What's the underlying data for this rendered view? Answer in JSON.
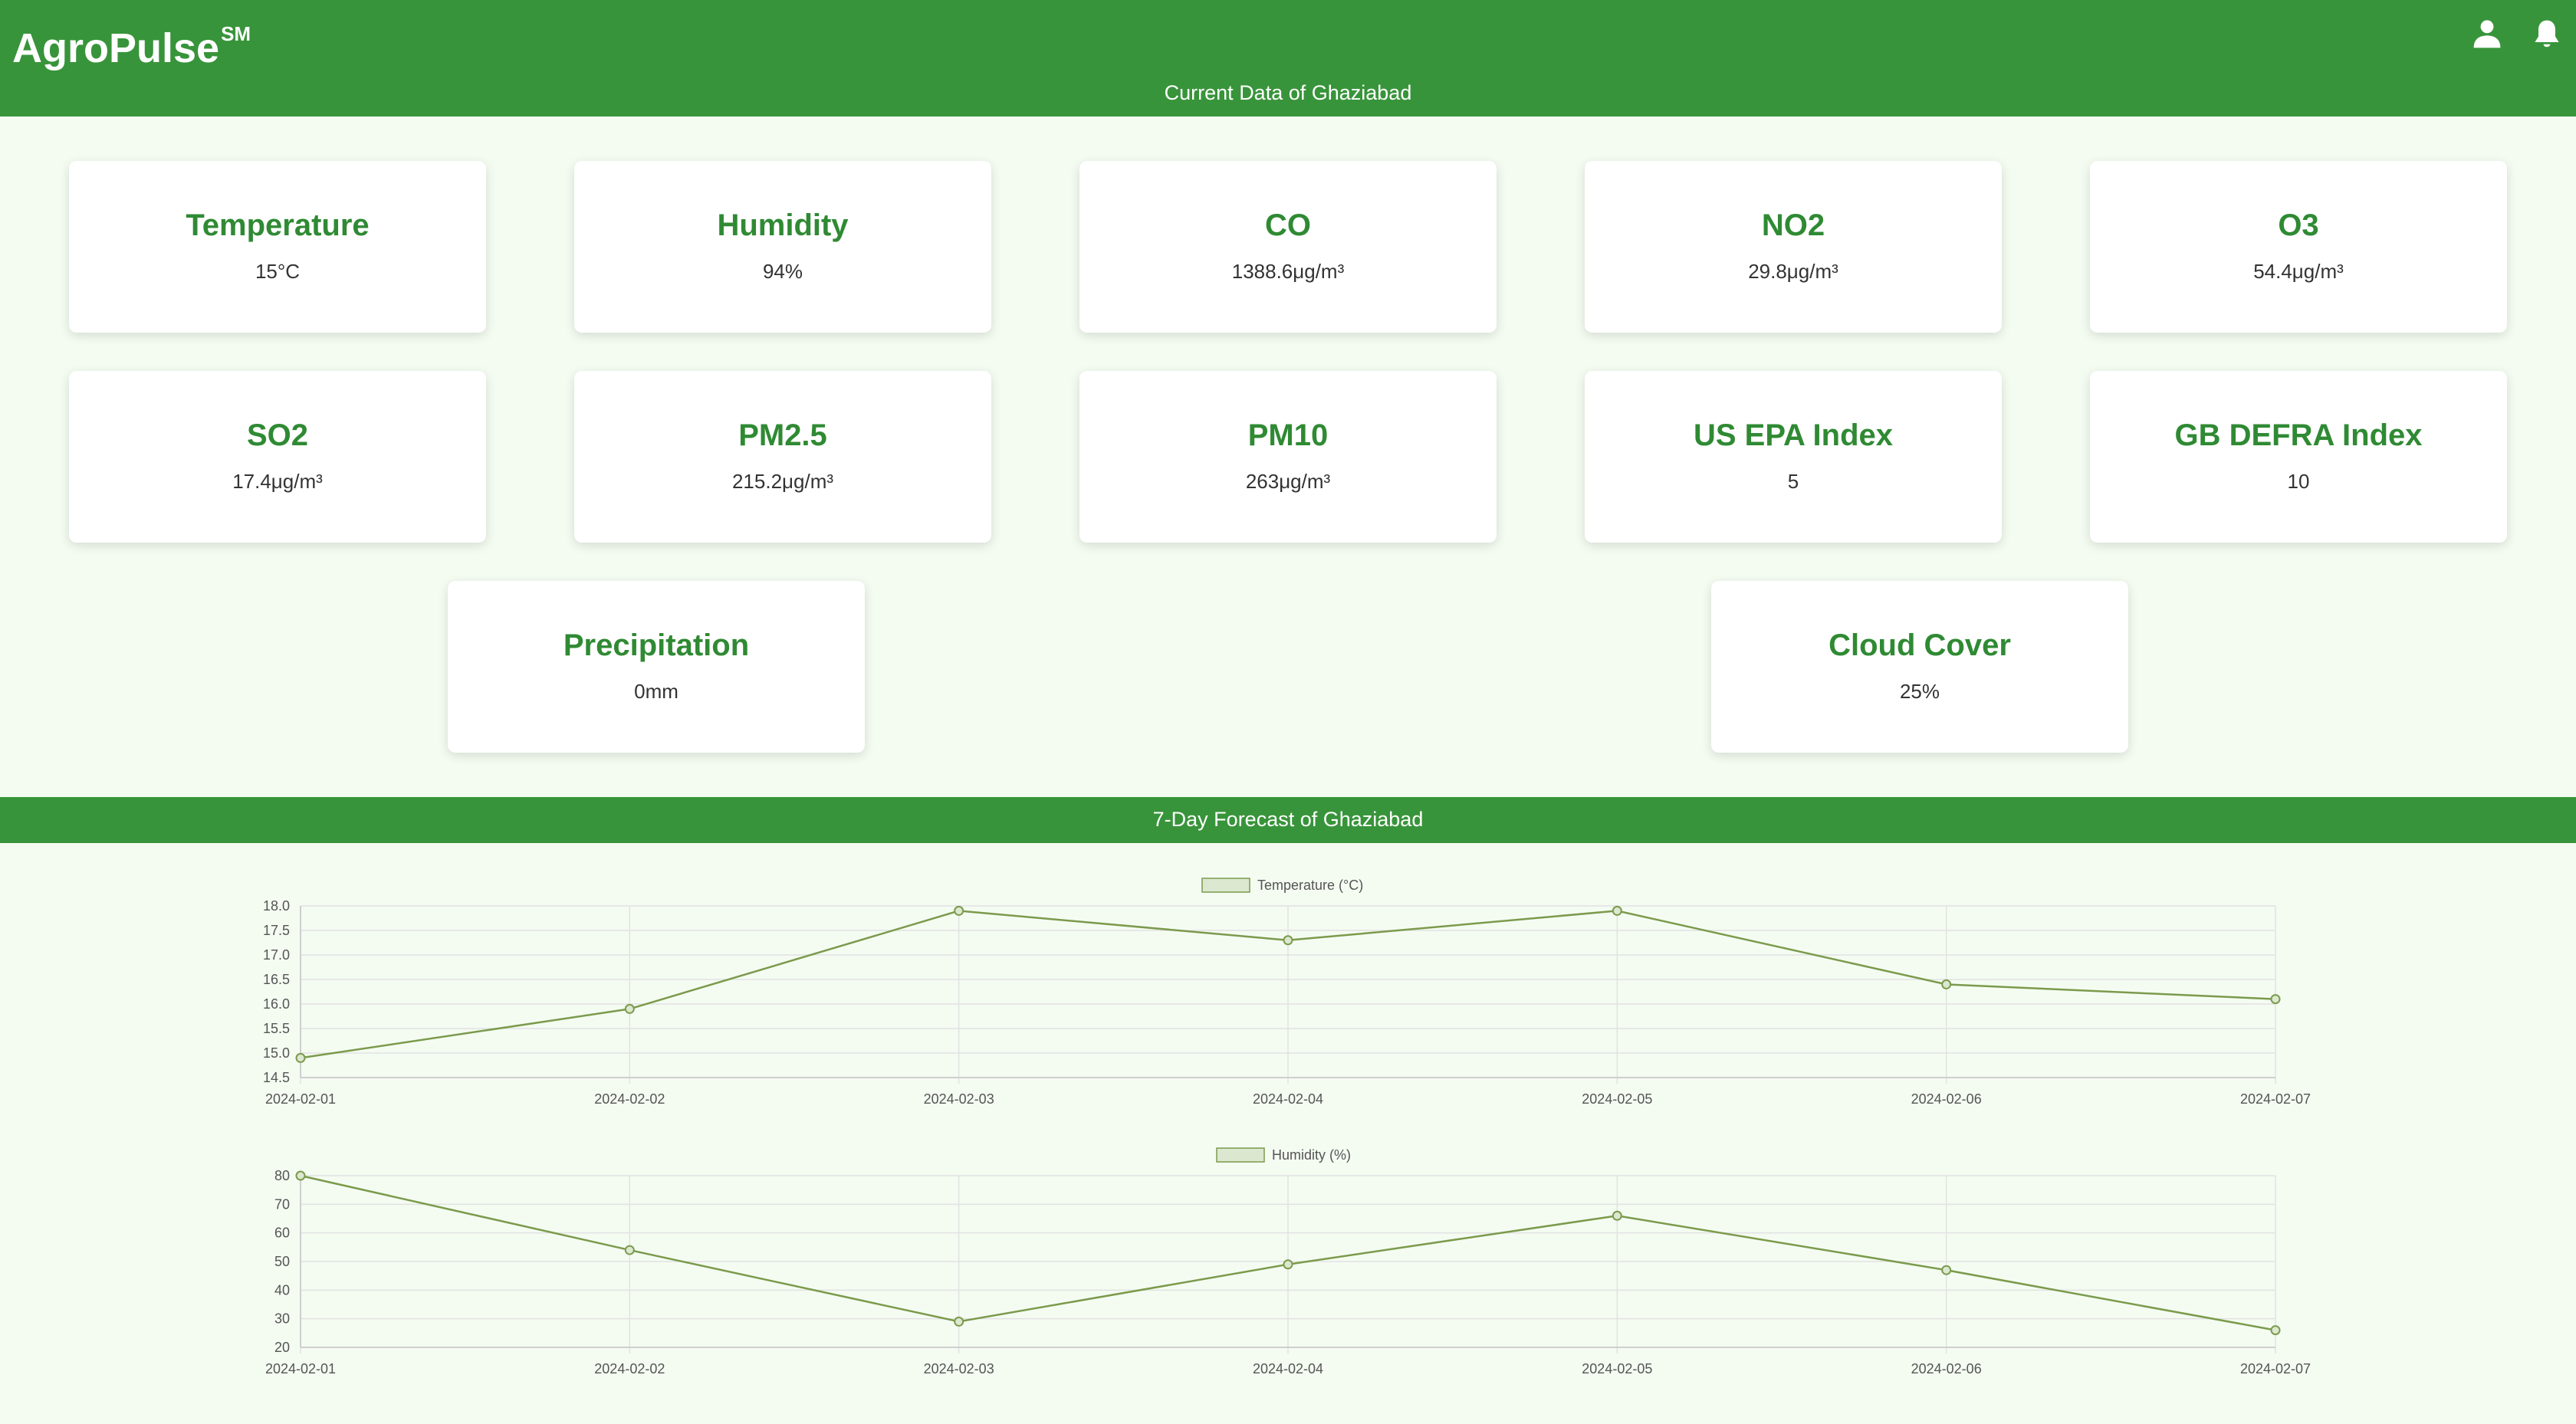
{
  "app": {
    "name": "AgroPulse",
    "mark": "SM"
  },
  "header": {
    "subtitle": "Current Data of Ghaziabad",
    "icons": [
      "user-icon",
      "bell-icon"
    ]
  },
  "cards": [
    {
      "title": "Temperature",
      "value": "15°C"
    },
    {
      "title": "Humidity",
      "value": "94%"
    },
    {
      "title": "CO",
      "value": "1388.6μg/m³"
    },
    {
      "title": "NO2",
      "value": "29.8μg/m³"
    },
    {
      "title": "O3",
      "value": "54.4μg/m³"
    },
    {
      "title": "SO2",
      "value": "17.4μg/m³"
    },
    {
      "title": "PM2.5",
      "value": "215.2μg/m³"
    },
    {
      "title": "PM10",
      "value": "263μg/m³"
    },
    {
      "title": "US EPA Index",
      "value": "5"
    },
    {
      "title": "GB DEFRA Index",
      "value": "10"
    },
    {
      "title": "Precipitation",
      "value": "0mm"
    },
    {
      "title": "Cloud Cover",
      "value": "25%"
    }
  ],
  "forecast": {
    "title": "7-Day Forecast of Ghaziabad"
  },
  "colors": {
    "brand": "#38943a",
    "heading": "#2f8a33",
    "line": "#7c9a4c",
    "legendFill": "#dbe8cf"
  },
  "chart_data": [
    {
      "type": "line",
      "x": [
        "2024-02-01",
        "2024-02-02",
        "2024-02-03",
        "2024-02-04",
        "2024-02-05",
        "2024-02-06",
        "2024-02-07"
      ],
      "series": [
        {
          "name": "Temperature (°C)",
          "values": [
            14.9,
            15.9,
            17.9,
            17.3,
            17.9,
            16.4,
            16.1
          ]
        }
      ],
      "yticks": [
        "14.5",
        "15.0",
        "15.5",
        "16.0",
        "16.5",
        "17.0",
        "17.5",
        "18.0"
      ],
      "ylim": [
        14.5,
        18.0
      ],
      "grid": true,
      "legend": "top-center"
    },
    {
      "type": "line",
      "x": [
        "2024-02-01",
        "2024-02-02",
        "2024-02-03",
        "2024-02-04",
        "2024-02-05",
        "2024-02-06",
        "2024-02-07"
      ],
      "series": [
        {
          "name": "Humidity (%)",
          "values": [
            80,
            54,
            29,
            49,
            66,
            47,
            26
          ]
        }
      ],
      "yticks": [
        "20",
        "30",
        "40",
        "50",
        "60",
        "70",
        "80"
      ],
      "ylim": [
        20,
        80
      ],
      "grid": true,
      "legend": "top-center"
    }
  ]
}
